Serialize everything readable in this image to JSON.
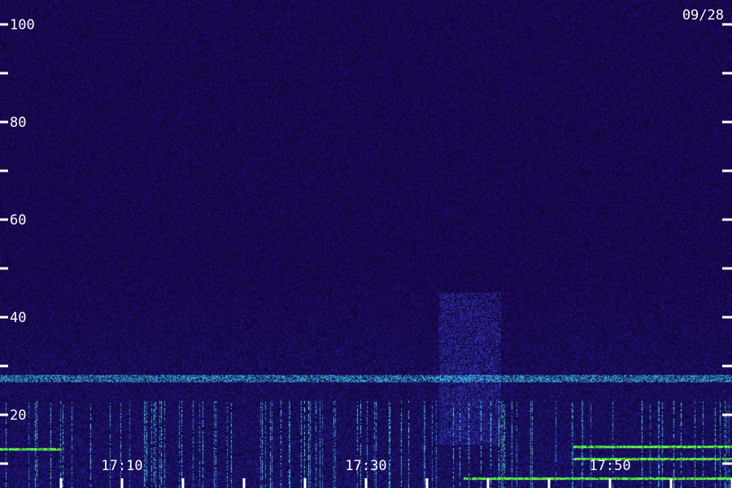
{
  "chart_data": {
    "type": "heatmap",
    "date_label": "09/28",
    "y_ticks": [
      {
        "value": 100,
        "label": "100"
      },
      {
        "value": 90,
        "label": ""
      },
      {
        "value": 80,
        "label": "80"
      },
      {
        "value": 70,
        "label": ""
      },
      {
        "value": 60,
        "label": "60"
      },
      {
        "value": 50,
        "label": ""
      },
      {
        "value": 40,
        "label": "40"
      },
      {
        "value": 30,
        "label": ""
      },
      {
        "value": 20,
        "label": "20"
      },
      {
        "value": 10,
        "label": ""
      }
    ],
    "x_ticks": [
      {
        "time": "17:05",
        "label": ""
      },
      {
        "time": "17:10",
        "label": "17:10"
      },
      {
        "time": "17:15",
        "label": ""
      },
      {
        "time": "17:20",
        "label": ""
      },
      {
        "time": "17:25",
        "label": ""
      },
      {
        "time": "17:30",
        "label": "17:30"
      },
      {
        "time": "17:35",
        "label": ""
      },
      {
        "time": "17:40",
        "label": ""
      },
      {
        "time": "17:45",
        "label": ""
      },
      {
        "time": "17:50",
        "label": "17:50"
      },
      {
        "time": "17:55",
        "label": ""
      },
      {
        "time": "18:00",
        "label": ""
      }
    ],
    "ylim": [
      5,
      105
    ],
    "xlim": [
      "17:00",
      "18:00"
    ],
    "colors": {
      "background": "#2a0c88",
      "band_cyan": "#3fc8ff",
      "line_green": "#60ff40",
      "label": "#ffffff"
    },
    "features": [
      {
        "kind": "horizontal_band",
        "y": 27.5,
        "color": "band_cyan",
        "x_start": "17:00",
        "x_end": "18:00"
      },
      {
        "kind": "horizontal_line",
        "y": 13,
        "color": "line_green",
        "x_start": "17:00",
        "x_end": "17:05"
      },
      {
        "kind": "horizontal_line",
        "y": 11,
        "color": "line_green",
        "x_start": "17:47",
        "x_end": "18:00"
      },
      {
        "kind": "horizontal_line",
        "y": 13.5,
        "color": "line_green",
        "x_start": "17:47",
        "x_end": "18:00"
      },
      {
        "kind": "horizontal_line",
        "y": 7,
        "color": "line_green",
        "x_start": "17:38",
        "x_end": "18:00"
      },
      {
        "kind": "brightening",
        "x_start": "17:36",
        "x_end": "17:41",
        "y_min": 14,
        "y_max": 45
      }
    ]
  }
}
